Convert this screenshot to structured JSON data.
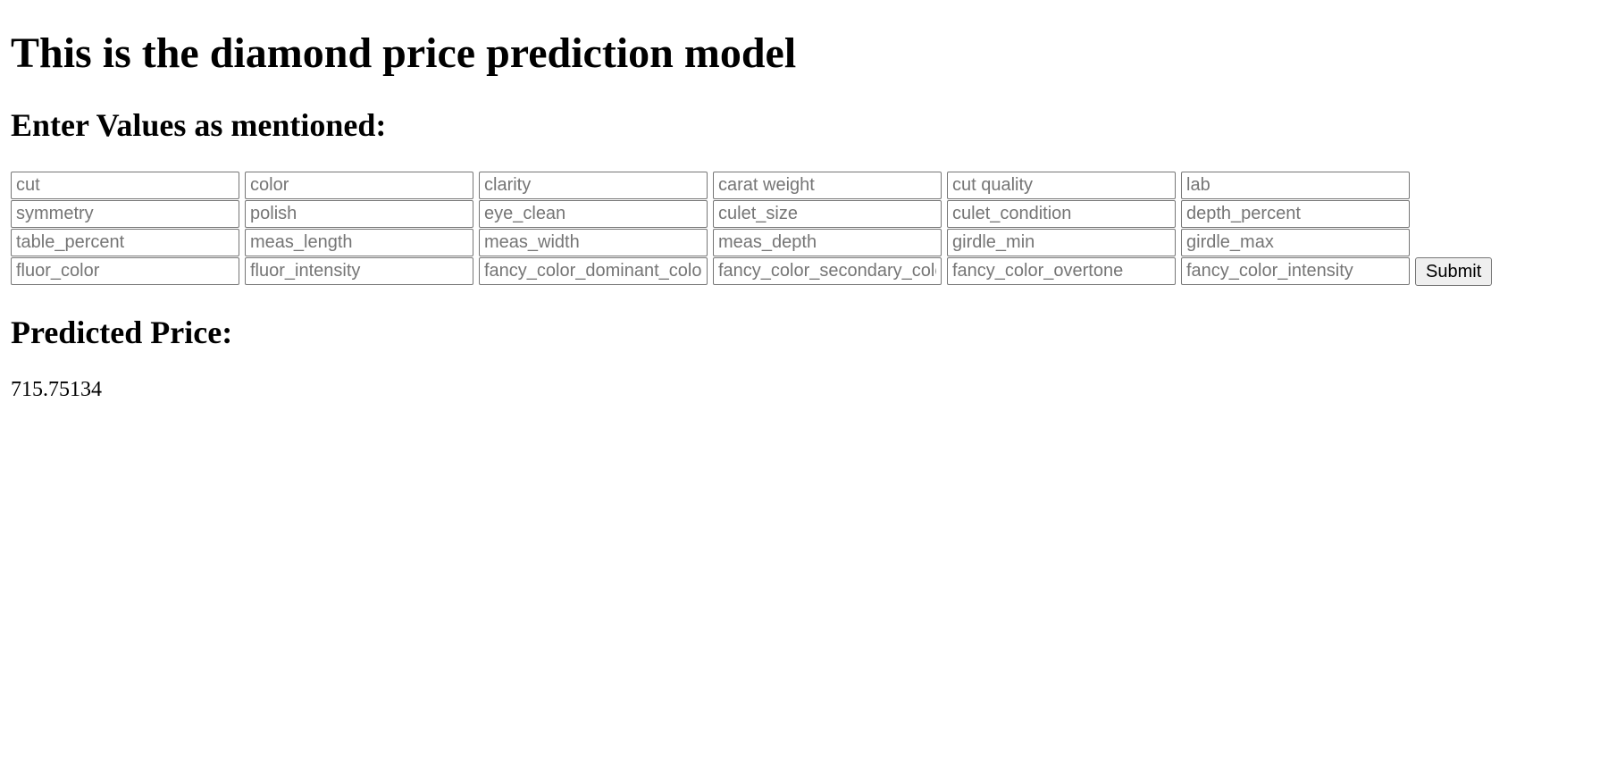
{
  "page": {
    "title": "This is the diamond price prediction model",
    "subtitle": "Enter Values as mentioned:"
  },
  "form": {
    "rows": [
      [
        "cut",
        "color",
        "clarity",
        "carat weight",
        "cut quality",
        "lab"
      ],
      [
        "symmetry",
        "polish",
        "eye_clean",
        "culet_size",
        "culet_condition",
        "depth_percent"
      ],
      [
        "table_percent",
        "meas_length",
        "meas_width",
        "meas_depth",
        "girdle_min",
        "girdle_max"
      ],
      [
        "fluor_color",
        "fluor_intensity",
        "fancy_color_dominant_color",
        "fancy_color_secondary_color",
        "fancy_color_overtone",
        "fancy_color_intensity"
      ]
    ],
    "submit_label": "Submit"
  },
  "result": {
    "title": "Predicted Price:",
    "value": "715.75134"
  }
}
